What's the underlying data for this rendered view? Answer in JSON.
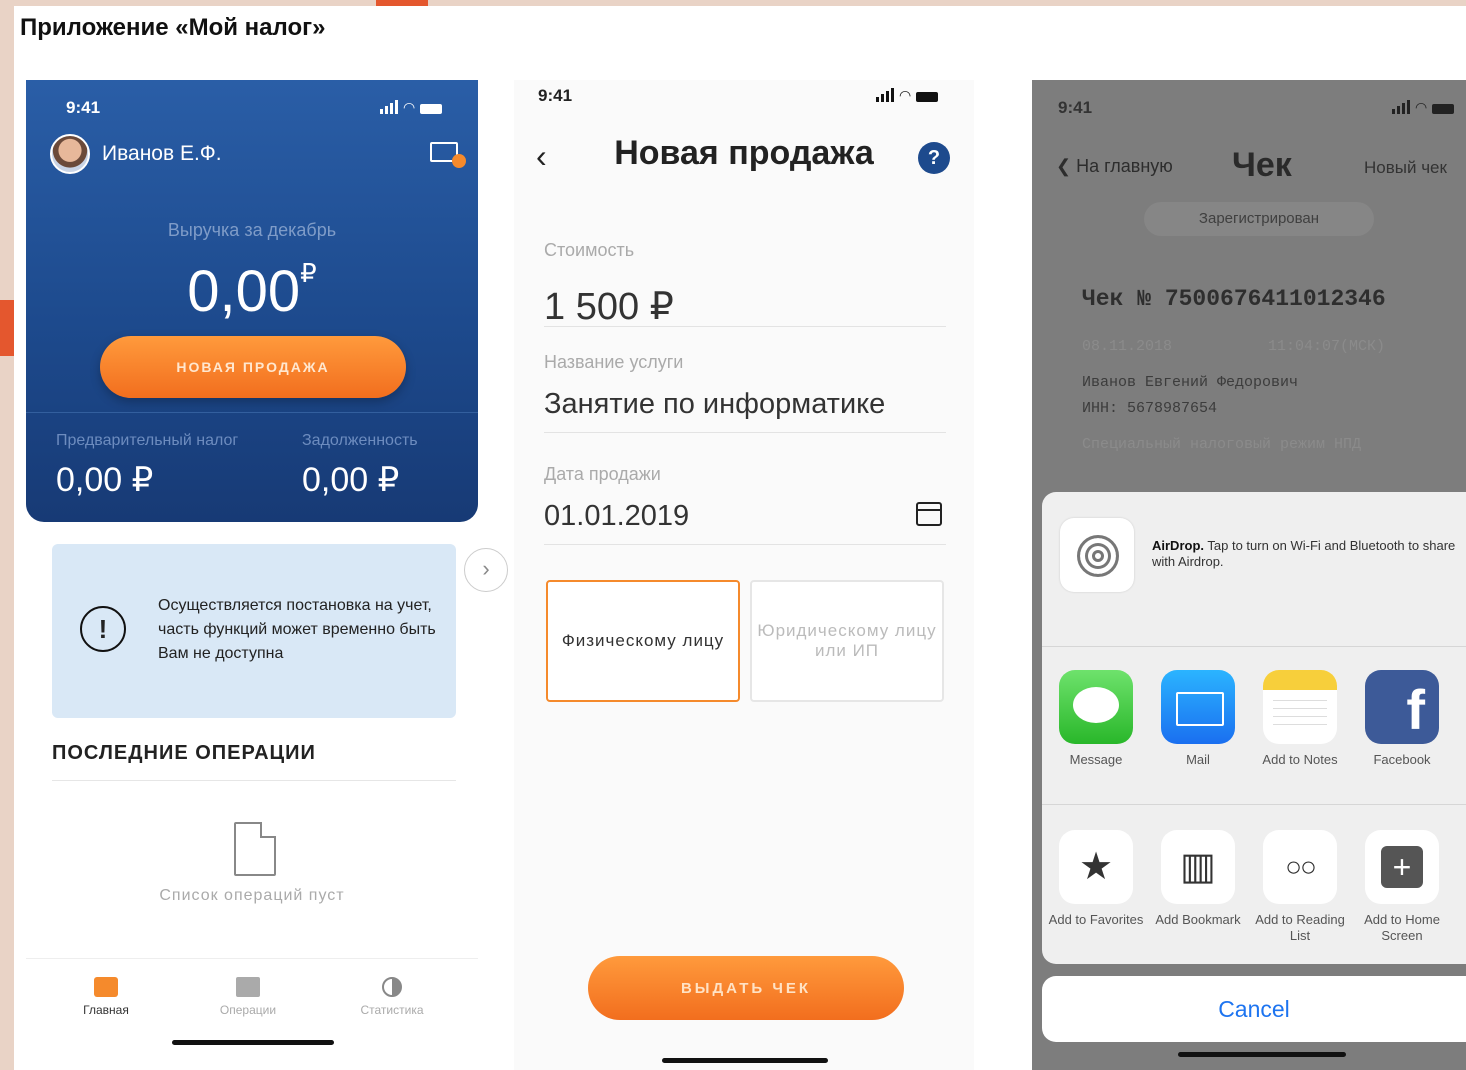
{
  "page_title": "Приложение «Мой налог»",
  "colors": {
    "brand_blue": "#1d4a8d",
    "accent_orange": "#f58a2c",
    "ios_blue": "#1d74f0"
  },
  "screen1": {
    "time": "9:41",
    "user_name": "Иванов Е.Ф.",
    "revenue_label": "Выручка за декабрь",
    "revenue_value": "0,00",
    "currency_mark": "₽",
    "new_sale_label": "НОВАЯ ПРОДАЖА",
    "stats": [
      {
        "label": "Предварительный налог",
        "value": "0,00 ₽"
      },
      {
        "label": "Задолженность",
        "value": "0,00 ₽"
      }
    ],
    "next_arrow": "›",
    "notice_icon": "!",
    "notice_text": "Осуществляется постановка на учет, часть функций может временно быть Вам не доступна",
    "ops_title": "ПОСЛЕДНИЕ ОПЕРАЦИИ",
    "empty_text": "Список операций пуст",
    "tabs": [
      {
        "label": "Главная",
        "icon": "briefcase-icon",
        "active": true
      },
      {
        "label": "Операции",
        "icon": "folder-icon",
        "active": false
      },
      {
        "label": "Статистика",
        "icon": "pie-chart-icon",
        "active": false
      }
    ]
  },
  "screen2": {
    "time": "9:41",
    "back": "‹",
    "title": "Новая продажа",
    "help": "?",
    "price_label": "Стоимость",
    "price_value": "1 500 ₽",
    "service_label": "Название услуги",
    "service_value": "Занятие по информатике",
    "date_label": "Дата продажи",
    "date_value": "01.01.2019",
    "buyer_options": [
      "Физическому лицу",
      "Юридическому лицу или ИП"
    ],
    "issue_label": "ВЫДАТЬ ЧЕК"
  },
  "screen3": {
    "time": "9:41",
    "back_label": "❮ На главную",
    "title": "Чек",
    "new_check": "Новый чек",
    "status": "Зарегистрирован",
    "receipt_number": "Чек № 7500676411012346",
    "receipt_date": "08.11.2018",
    "receipt_time": "11:04:07(МСК)",
    "receipt_name": "Иванов Евгений Федорович",
    "receipt_inn": "ИНН: 5678987654",
    "receipt_regime": "Специальный налоговый режим НПД",
    "airdrop_title": "AirDrop.",
    "airdrop_text": "Tap to turn on Wi-Fi and Bluetooth to share with Airdrop.",
    "share_apps": [
      {
        "label": "Message",
        "icon": "message-icon"
      },
      {
        "label": "Mail",
        "icon": "mail-icon"
      },
      {
        "label": "Add to Notes",
        "icon": "notes-icon"
      },
      {
        "label": "Facebook",
        "icon": "facebook-icon"
      }
    ],
    "actions": [
      {
        "label": "Add to Favorites",
        "icon": "star-icon"
      },
      {
        "label": "Add Bookmark",
        "icon": "book-icon"
      },
      {
        "label": "Add to Reading List",
        "icon": "glasses-icon"
      },
      {
        "label": "Add to Home Screen",
        "icon": "plus-square-icon"
      }
    ],
    "cancel_label": "Cancel"
  }
}
